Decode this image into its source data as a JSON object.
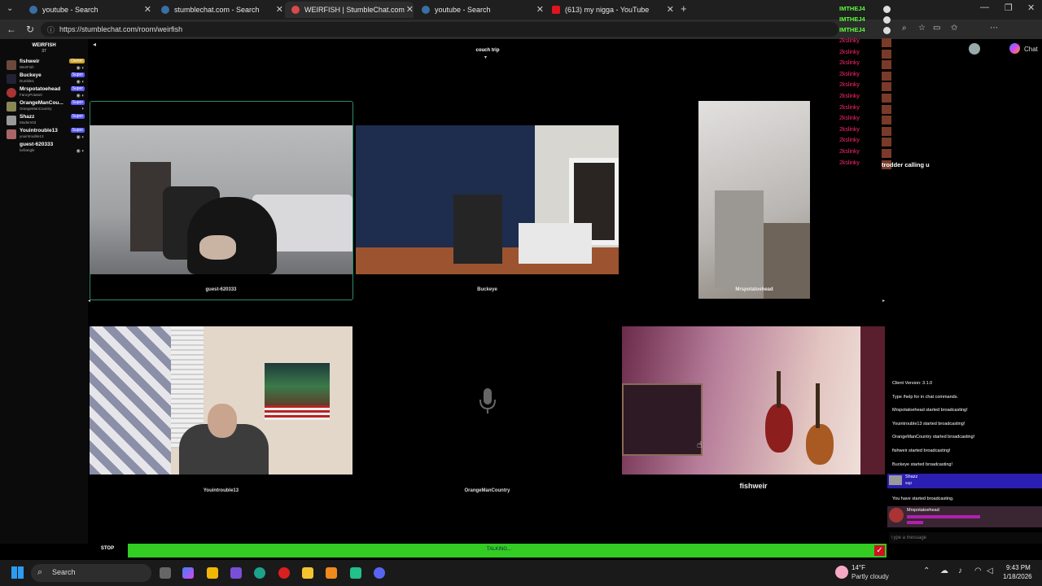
{
  "browser": {
    "tabs": [
      {
        "title": "youtube - Search",
        "active": false
      },
      {
        "title": "stumblechat.com - Search",
        "active": false
      },
      {
        "title": "WEIRFISH | StumbleChat.com",
        "active": true
      },
      {
        "title": "youtube - Search",
        "active": false
      },
      {
        "title": "(613) my nigga - YouTube",
        "active": false
      }
    ],
    "url": "https://stumblechat.com/room/weirfish",
    "chat_button": "Chat"
  },
  "room": {
    "name": "WEIRFISH",
    "count": "37",
    "topic": "couch trip"
  },
  "users": [
    {
      "name": "fishweir",
      "nick": "WeirFish",
      "badge": "Owner",
      "badge_color": "#c9a227"
    },
    {
      "name": "Buckeye",
      "nick": "Dumble1",
      "badge": "Super",
      "badge_color": "#5a5aff"
    },
    {
      "name": "Mrspotatoehead",
      "nick": "FancyPotato0",
      "badge": "Super",
      "badge_color": "#5a5aff"
    },
    {
      "name": "OrangeManCou...",
      "nick": "OrangeManCountry",
      "badge": "Super",
      "badge_color": "#5a5aff"
    },
    {
      "name": "Shazz",
      "nick": "Modern03",
      "badge": "Super",
      "badge_color": "#5a5aff"
    },
    {
      "name": "Youintrouble13",
      "nick": "youintrouble13",
      "badge": "Super",
      "badge_color": "#5a5aff"
    },
    {
      "name": "guest-620333",
      "nick": "lurbangle",
      "badge": "",
      "badge_color": "#000"
    }
  ],
  "cams": [
    {
      "label": "guest-620333"
    },
    {
      "label": "Buckeye"
    },
    {
      "label": "Mrspotatoehead"
    },
    {
      "label": "Youintrouble13"
    },
    {
      "label": "OrangeManCountry"
    },
    {
      "label": "fishweir"
    }
  ],
  "overlay": {
    "green_lines": [
      "IMTHEJ4",
      "IMTHEJ4",
      "IMTHEJ4"
    ],
    "pink_label": "2kslinky",
    "pink_count": 12,
    "trailing_text": "trodder calling u"
  },
  "chat": {
    "system": [
      "Client Version: 3.1.0",
      "Type /help for in chat commands.",
      "Mrspotatoehead started broadcasting!",
      "Youintrouble13 started broadcasting!",
      "OrangeManCountry started broadcasting!",
      "fishweir started broadcasting!",
      "Buckeye started broadcasting!"
    ],
    "msg1_user": "Shazz",
    "msg1_text": "sup",
    "you_started": "You have started broadcasting.",
    "msg2_user": "Mrspotatoehead",
    "input_placeholder": "Type a message"
  },
  "controls": {
    "stop": "STOP",
    "talking": "TALKING..."
  },
  "taskbar": {
    "search": "Search",
    "weather_temp": "14°F",
    "weather_desc": "Partly cloudy",
    "time": "9:43 PM",
    "date": "1/18/2026"
  }
}
